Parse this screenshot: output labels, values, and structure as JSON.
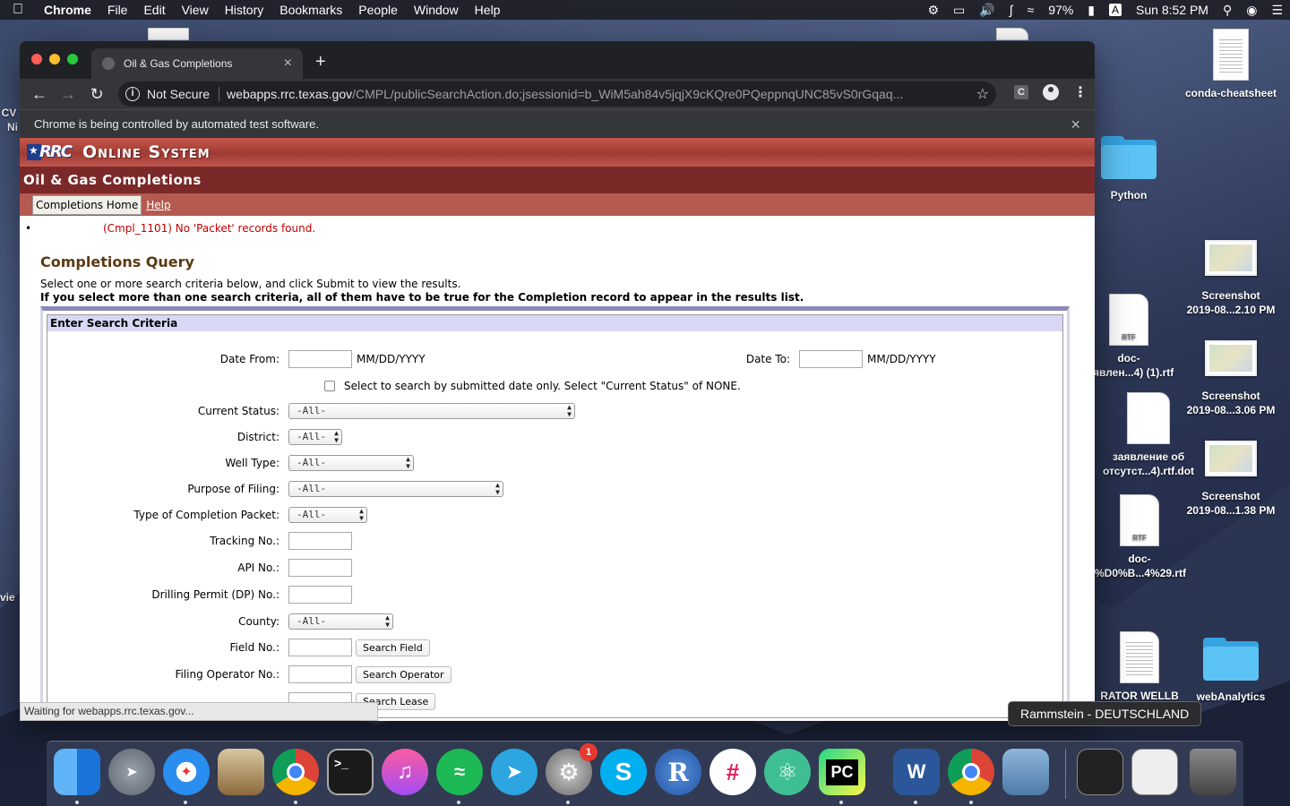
{
  "menubar": {
    "app": "Chrome",
    "items": [
      "File",
      "Edit",
      "View",
      "History",
      "Bookmarks",
      "People",
      "Window",
      "Help"
    ],
    "battery": "97%",
    "input_source": "A",
    "clock": "Sun 8:52 PM"
  },
  "desktop": {
    "icons": [
      {
        "label": "conda-cheatsheet"
      },
      {
        "label": "Python"
      },
      {
        "label": "Screenshot",
        "label2": "2019-08...2.10 PM"
      },
      {
        "label": "doc-",
        "label2": "явлен...4) (1).rtf"
      },
      {
        "label": "Screenshot",
        "label2": "2019-08...3.06 PM"
      },
      {
        "label": "заявление об",
        "label2": "отсутст...4).rtf.dot"
      },
      {
        "label": "Screenshot",
        "label2": "2019-08...1.38 PM"
      },
      {
        "label": "doc-",
        "label2": "%D0%B...4%29.rtf"
      },
      {
        "label": "RATOR WELLB"
      },
      {
        "label": "webAnalytics"
      }
    ],
    "left_edge": [
      "CV",
      "Ni",
      "vie"
    ]
  },
  "browser": {
    "tab_title": "Oil & Gas Completions",
    "security": "Not Secure",
    "url_host": "webapps.rrc.texas.gov",
    "url_path": "/CMPL/publicSearchAction.do;jsessionid=b_WiM5ah84v5jqjX9cKQre0PQeppnqUNC85vS0rGqaq...",
    "infobar": "Chrome is being controlled by automated test software.",
    "ext_label": "C",
    "status": "Waiting for webapps.rrc.texas.gov..."
  },
  "page": {
    "logo_text": "RRC",
    "system_title": "Online System",
    "app_title": "Oil & Gas Completions",
    "nav_home": "Completions Home",
    "nav_help": "Help",
    "error": "(Cmpl_1101) No 'Packet' records found.",
    "query_title": "Completions Query",
    "desc1": "Select one or more search criteria below, and click Submit to view the results.",
    "desc2": "If you select more than one search criteria, all of them have to be true for the Completion record to appear in the results list.",
    "criteria_header": "Enter Search Criteria",
    "fields": {
      "date_from": "Date From:",
      "date_to": "Date To:",
      "date_fmt": "MM/DD/YYYY",
      "submitted_only": "Select to search by submitted date only. Select \"Current Status\" of NONE.",
      "current_status": "Current Status:",
      "district": "District:",
      "well_type": "Well Type:",
      "purpose": "Purpose of Filing:",
      "packet_type": "Type of Completion Packet:",
      "tracking": "Tracking No.:",
      "api": "API No.:",
      "dp": "Drilling Permit (DP) No.:",
      "county": "County:",
      "field_no": "Field No.:",
      "operator_no": "Filing Operator No.:",
      "all": "-All-",
      "search_field": "Search Field",
      "search_operator": "Search Operator",
      "search_lease": "Search Lease"
    }
  },
  "tooltip": "Rammstein - DEUTSCHLAND",
  "dock": {
    "badge_count": "1"
  }
}
